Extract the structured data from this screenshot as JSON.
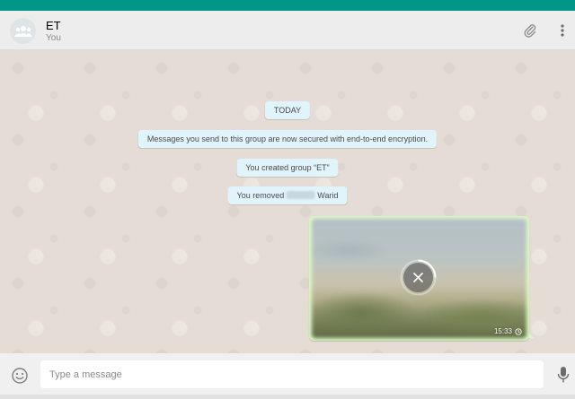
{
  "header": {
    "title": "ET",
    "subtitle": "You",
    "avatar_icon": "group-avatar-icon",
    "attach_icon": "paperclip-icon",
    "menu_icon": "more-vertical-icon"
  },
  "chat": {
    "date_label": "TODAY",
    "system_messages": {
      "encryption": "Messages you send to this group are now secured with end-to-end encryption.",
      "created": "You created group “ET”",
      "removed_prefix": "You removed",
      "removed_suffix": "Warid"
    },
    "image_message": {
      "time": "15:33",
      "status_icon": "clock-pending-icon",
      "action_icon": "cancel-download-icon"
    }
  },
  "composer": {
    "placeholder": "Type a message",
    "emoji_icon": "smiley-icon",
    "mic_icon": "microphone-icon"
  },
  "colors": {
    "topbar": "#009688",
    "outgoing_bubble": "#dcf8c6",
    "system_bubble": "#e1f3fb",
    "chat_background": "#e5ddd5"
  }
}
